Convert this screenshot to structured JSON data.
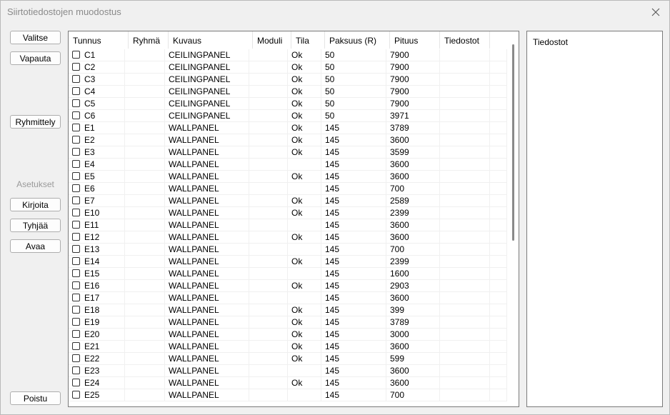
{
  "window": {
    "title": "Siirtotiedostojen muodostus"
  },
  "buttons": {
    "select": "Valitse",
    "release": "Vapauta",
    "group": "Ryhmittely",
    "settings": "Asetukset",
    "write": "Kirjoita",
    "clear": "Tyhjää",
    "open": "Avaa",
    "exit": "Poistu"
  },
  "table": {
    "columns": [
      "Tunnus",
      "Ryhmä",
      "Kuvaus",
      "Moduli",
      "Tila",
      "Paksuus (R)",
      "Pituus",
      "Tiedostot"
    ],
    "rows": [
      [
        "C1",
        "",
        "CEILINGPANEL",
        "",
        "Ok",
        "50",
        "7900"
      ],
      [
        "C2",
        "",
        "CEILINGPANEL",
        "",
        "Ok",
        "50",
        "7900"
      ],
      [
        "C3",
        "",
        "CEILINGPANEL",
        "",
        "Ok",
        "50",
        "7900"
      ],
      [
        "C4",
        "",
        "CEILINGPANEL",
        "",
        "Ok",
        "50",
        "7900"
      ],
      [
        "C5",
        "",
        "CEILINGPANEL",
        "",
        "Ok",
        "50",
        "7900"
      ],
      [
        "C6",
        "",
        "CEILINGPANEL",
        "",
        "Ok",
        "50",
        "3971"
      ],
      [
        "E1",
        "",
        "WALLPANEL",
        "",
        "Ok",
        "145",
        "3789"
      ],
      [
        "E2",
        "",
        "WALLPANEL",
        "",
        "Ok",
        "145",
        "3600"
      ],
      [
        "E3",
        "",
        "WALLPANEL",
        "",
        "Ok",
        "145",
        "3599"
      ],
      [
        "E4",
        "",
        "WALLPANEL",
        "",
        "",
        "145",
        "3600"
      ],
      [
        "E5",
        "",
        "WALLPANEL",
        "",
        "Ok",
        "145",
        "3600"
      ],
      [
        "E6",
        "",
        "WALLPANEL",
        "",
        "",
        "145",
        "700"
      ],
      [
        "E7",
        "",
        "WALLPANEL",
        "",
        "Ok",
        "145",
        "2589"
      ],
      [
        "E10",
        "",
        "WALLPANEL",
        "",
        "Ok",
        "145",
        "2399"
      ],
      [
        "E11",
        "",
        "WALLPANEL",
        "",
        "",
        "145",
        "3600"
      ],
      [
        "E12",
        "",
        "WALLPANEL",
        "",
        "Ok",
        "145",
        "3600"
      ],
      [
        "E13",
        "",
        "WALLPANEL",
        "",
        "",
        "145",
        "700"
      ],
      [
        "E14",
        "",
        "WALLPANEL",
        "",
        "Ok",
        "145",
        "2399"
      ],
      [
        "E15",
        "",
        "WALLPANEL",
        "",
        "",
        "145",
        "1600"
      ],
      [
        "E16",
        "",
        "WALLPANEL",
        "",
        "Ok",
        "145",
        "2903"
      ],
      [
        "E17",
        "",
        "WALLPANEL",
        "",
        "",
        "145",
        "3600"
      ],
      [
        "E18",
        "",
        "WALLPANEL",
        "",
        "Ok",
        "145",
        "399"
      ],
      [
        "E19",
        "",
        "WALLPANEL",
        "",
        "Ok",
        "145",
        "3789"
      ],
      [
        "E20",
        "",
        "WALLPANEL",
        "",
        "Ok",
        "145",
        "3000"
      ],
      [
        "E21",
        "",
        "WALLPANEL",
        "",
        "Ok",
        "145",
        "3600"
      ],
      [
        "E22",
        "",
        "WALLPANEL",
        "",
        "Ok",
        "145",
        "599"
      ],
      [
        "E23",
        "",
        "WALLPANEL",
        "",
        "",
        "145",
        "3600"
      ],
      [
        "E24",
        "",
        "WALLPANEL",
        "",
        "Ok",
        "145",
        "3600"
      ],
      [
        "E25",
        "",
        "WALLPANEL",
        "",
        "",
        "145",
        "700"
      ]
    ]
  },
  "files_panel": {
    "header": "Tiedostot"
  },
  "icons": {
    "close": "close-icon",
    "checkbox": "checkbox-icon"
  }
}
